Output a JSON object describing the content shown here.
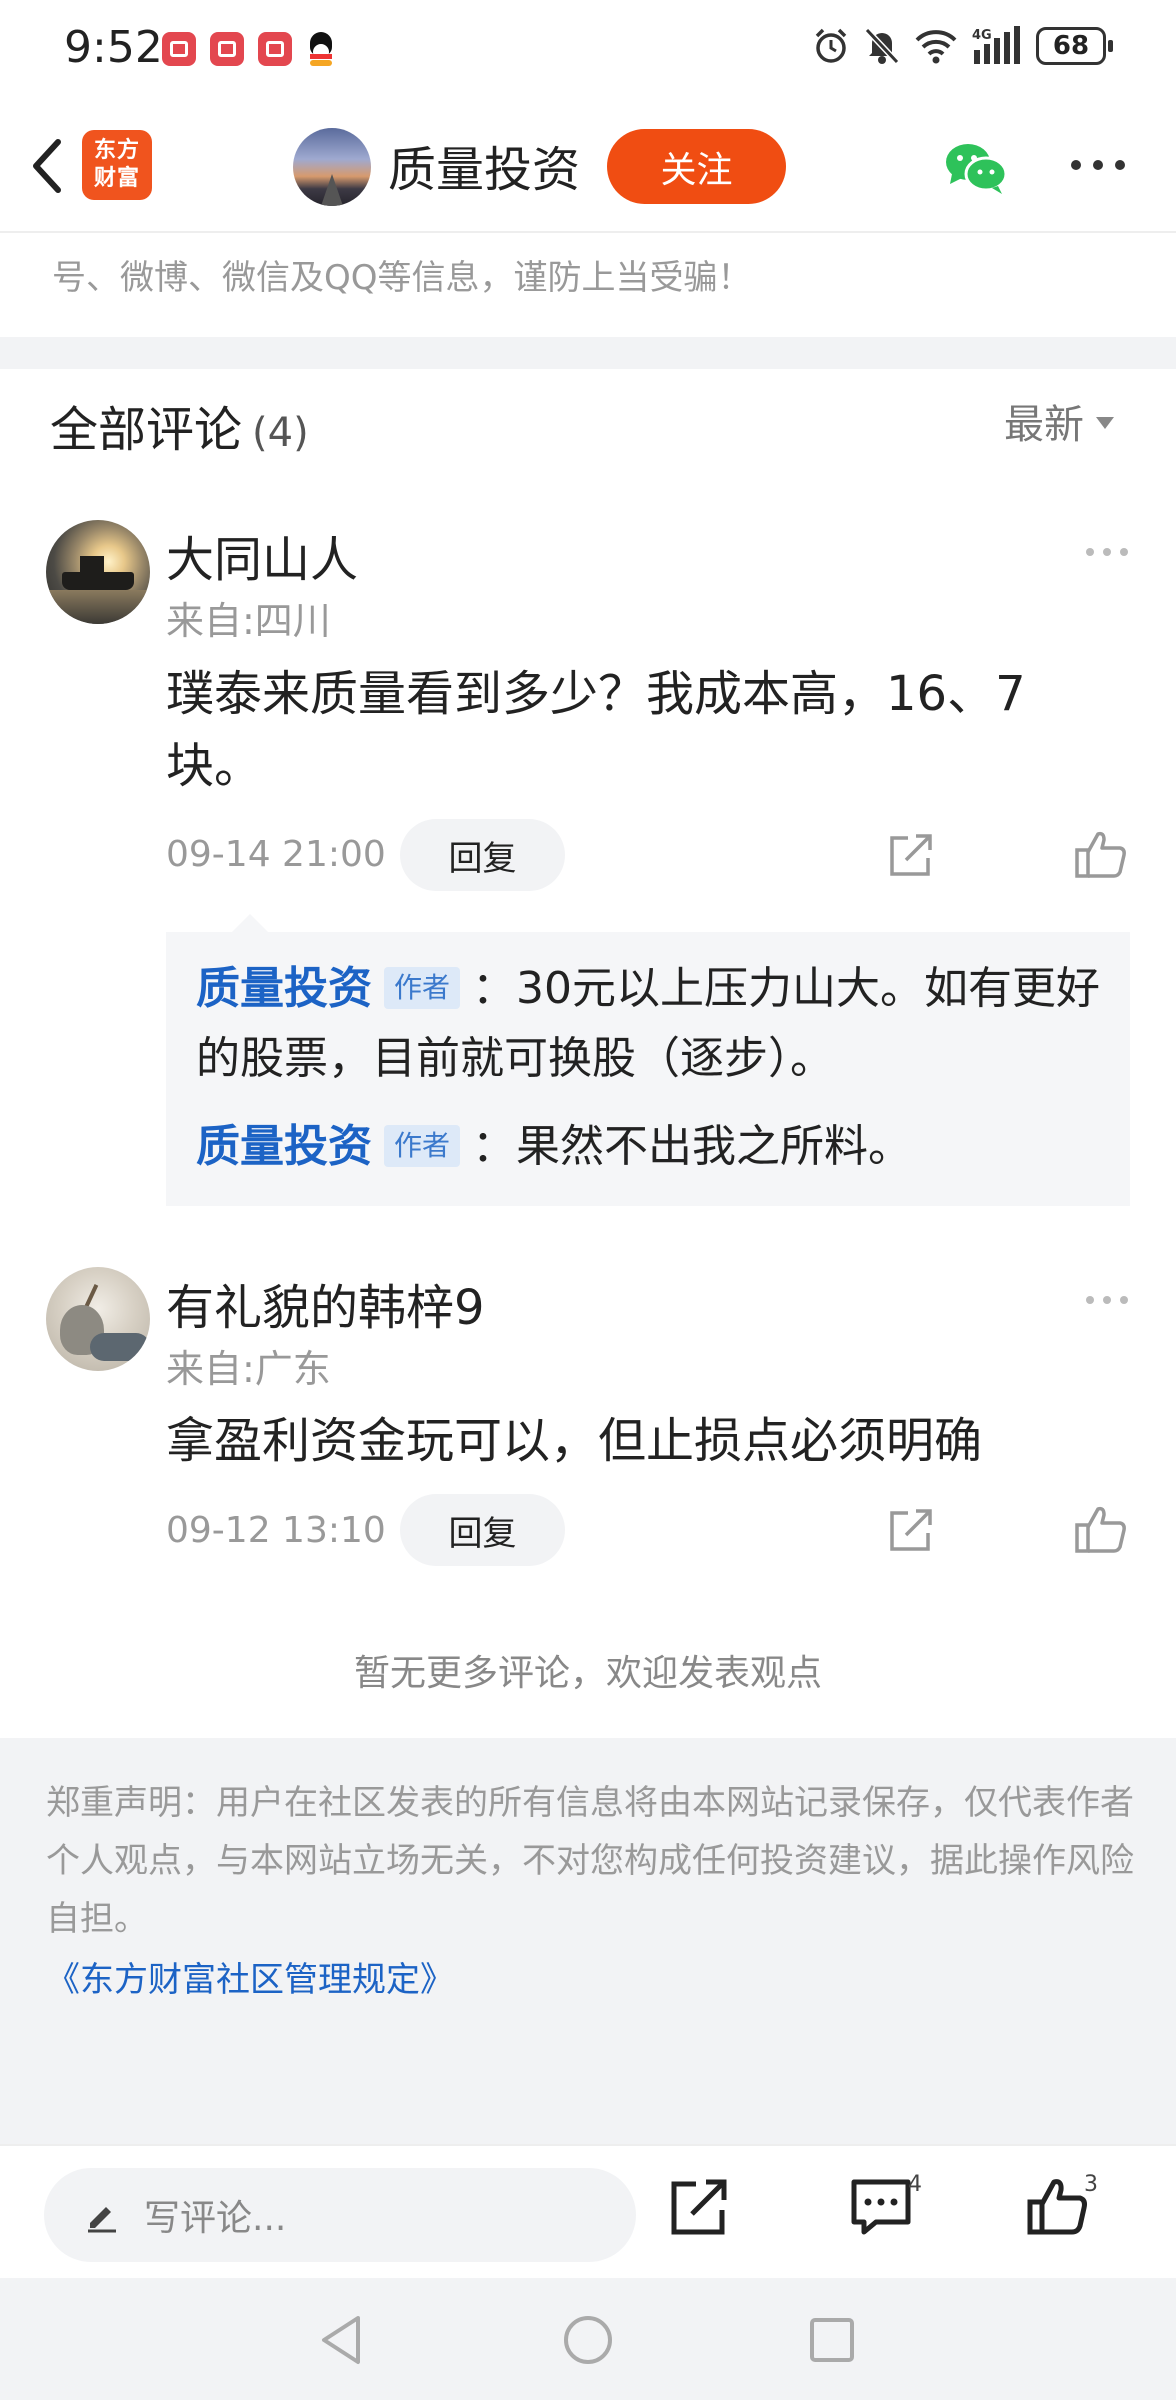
{
  "status_bar": {
    "time": "9:52",
    "battery": "68",
    "network": "4G",
    "icons": [
      "red-notification-icon",
      "red-notification-icon",
      "red-notification-icon",
      "qq-icon",
      "alarm-icon",
      "mute-icon",
      "wifi-icon",
      "signal-icon",
      "battery-icon"
    ]
  },
  "nav": {
    "logo_line1": "东方",
    "logo_line2": "财富",
    "title": "质量投资",
    "follow_label": "关注",
    "follow_color": "#f04d12"
  },
  "notice": "号、微博、微信及QQ等信息，谨防上当受骗！",
  "comments_section": {
    "title": "全部评论",
    "count": "(4)",
    "sort_label": "最新"
  },
  "comments": [
    {
      "name": "大同山人",
      "location": "来自:四川",
      "text": "璞泰来质量看到多少？我成本高，16、7块。",
      "time": "09-14 21:00",
      "reply_label": "回复",
      "replies": [
        {
          "author": "质量投资",
          "tag": "作者",
          "text": "：30元以上压力山大。如有更好的股票，目前就可换股（逐步）。"
        },
        {
          "author": "质量投资",
          "tag": "作者",
          "text": "：果然不出我之所料。"
        }
      ]
    },
    {
      "name": "有礼貌的韩梓9",
      "location": "来自:广东",
      "text": "拿盈利资金玩可以，但止损点必须明确",
      "time": "09-12 13:10",
      "reply_label": "回复"
    }
  ],
  "no_more": "暂无更多评论，欢迎发表观点",
  "disclaimer": {
    "text": "郑重声明：用户在社区发表的所有信息将由本网站记录保存，仅代表作者个人观点，与本网站立场无关，不对您构成任何投资建议，据此操作风险自担。",
    "link": "《东方财富社区管理规定》"
  },
  "bottom_bar": {
    "input_placeholder": "写评论...",
    "comment_count": "4",
    "like_count": "3"
  },
  "colors": {
    "accent": "#f04d12",
    "link_blue": "#1c63c5"
  }
}
